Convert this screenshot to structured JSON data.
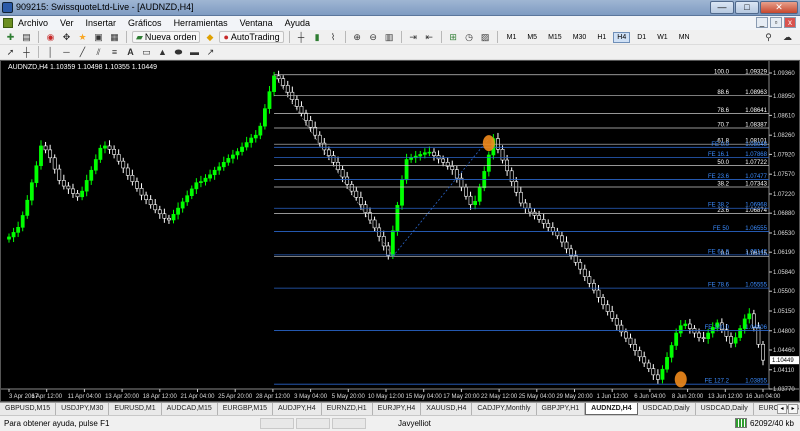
{
  "window": {
    "title": "909215: SwissquoteLtd-Live - [AUDNZD,H4]",
    "controls": [
      "—",
      "□",
      "✕"
    ]
  },
  "menu": {
    "items": [
      "Archivo",
      "Ver",
      "Insertar",
      "Gráficos",
      "Herramientas",
      "Ventana",
      "Ayuda"
    ],
    "mdi_controls": [
      "_",
      "▫",
      "x"
    ]
  },
  "toolbar": {
    "new_order_label": "Nueva orden",
    "autotrading_label": "AutoTrading",
    "timeframes": [
      "M1",
      "M5",
      "M15",
      "M30",
      "H1",
      "H4",
      "D1",
      "W1",
      "MN"
    ],
    "active_timeframe": "H4"
  },
  "chart_info": "AUDNZD,H4  1.10359 1.10498 1.10355 1.10449",
  "chart_data": {
    "type": "candlestick",
    "symbol": "AUDNZD",
    "timeframe": "H4",
    "ohlc_header": {
      "open": 1.10359,
      "high": 1.10498,
      "low": 1.10355,
      "close": 1.10449
    },
    "ylim": [
      1.0377,
      1.0936
    ],
    "y_ticks": [
      1.0936,
      1.0895,
      1.0861,
      1.0826,
      1.0792,
      1.0757,
      1.0722,
      1.0688,
      1.0653,
      1.0619,
      1.0584,
      1.055,
      1.0515,
      1.048,
      1.0446,
      1.0411,
      1.0377
    ],
    "x_ticks": [
      "3 Apr 2017",
      "6 Apr 12:00",
      "11 Apr 04:00",
      "13 Apr 20:00",
      "18 Apr 12:00",
      "21 Apr 04:00",
      "25 Apr 20:00",
      "28 Apr 12:00",
      "3 May 04:00",
      "5 May 20:00",
      "10 May 12:00",
      "15 May 04:00",
      "17 May 20:00",
      "22 May 12:00",
      "25 May 04:00",
      "29 May 20:00",
      "1 Jun 12:00",
      "6 Jun 04:00",
      "8 Jun 20:00",
      "13 Jun 12:00",
      "16 Jun 04:00"
    ],
    "close_series": [
      1.0646,
      1.0654,
      1.0663,
      1.0684,
      1.0711,
      1.0742,
      1.0772,
      1.0807,
      1.08,
      1.0786,
      1.0766,
      1.0746,
      1.0736,
      1.0731,
      1.0723,
      1.0717,
      1.0727,
      1.0746,
      1.0764,
      1.0783,
      1.0803,
      1.0807,
      1.0801,
      1.0792,
      1.078,
      1.0768,
      1.0755,
      1.0744,
      1.0732,
      1.072,
      1.0712,
      1.0703,
      1.0694,
      1.0687,
      1.0679,
      1.0676,
      1.0686,
      1.0697,
      1.0708,
      1.0719,
      1.0731,
      1.0742,
      1.0744,
      1.075,
      1.0756,
      1.0764,
      1.077,
      1.0778,
      1.0785,
      1.0791,
      1.0797,
      1.0805,
      1.0813,
      1.0821,
      1.0826,
      1.0842,
      1.0873,
      1.0903,
      1.0931,
      1.0926,
      1.0914,
      1.0902,
      1.0889,
      1.0877,
      1.0865,
      1.0852,
      1.084,
      1.0826,
      1.0812,
      1.08,
      1.079,
      1.0778,
      1.0765,
      1.0752,
      1.0739,
      1.0727,
      1.0716,
      1.0703,
      1.0689,
      1.0676,
      1.0662,
      1.0647,
      1.063,
      1.0613,
      1.0657,
      1.0702,
      1.0747,
      1.0783,
      1.0786,
      1.0789,
      1.0792,
      1.0795,
      1.0796,
      1.079,
      1.0784,
      1.0778,
      1.0771,
      1.0765,
      1.075,
      1.0734,
      1.0718,
      1.0703,
      1.0709,
      1.0733,
      1.0762,
      1.0791,
      1.082,
      1.0801,
      1.0782,
      1.0763,
      1.0744,
      1.0725,
      1.0706,
      1.0697,
      1.069,
      1.0684,
      1.0677,
      1.067,
      1.0663,
      1.0656,
      1.0648,
      1.0637,
      1.0625,
      1.0613,
      1.0601,
      1.0589,
      1.0576,
      1.0564,
      1.0552,
      1.0539,
      1.0526,
      1.0514,
      1.0502,
      1.049,
      1.0478,
      1.0467,
      1.0456,
      1.0445,
      1.0434,
      1.0423,
      1.0413,
      1.0402,
      1.0394,
      1.0412,
      1.0433,
      1.0454,
      1.0476,
      1.0489,
      1.0492,
      1.0484,
      1.0476,
      1.0468,
      1.0466,
      1.0476,
      1.0486,
      1.0494,
      1.0482,
      1.047,
      1.0458,
      1.0468,
      1.0484,
      1.0501,
      1.051,
      1.0486,
      1.0456,
      1.0428
    ],
    "fibonacci_retracement": [
      {
        "level": "100.0",
        "price": 1.09329
      },
      {
        "level": "88.6",
        "price": 1.08963
      },
      {
        "level": "78.6",
        "price": 1.08641
      },
      {
        "level": "70.7",
        "price": 1.08387
      },
      {
        "level": "61.8",
        "price": 1.08101
      },
      {
        "level": "50.0",
        "price": 1.07722
      },
      {
        "level": "38.2",
        "price": 1.07343
      },
      {
        "level": "23.6",
        "price": 1.06874
      },
      {
        "level": "0.0",
        "price": 1.06115
      }
    ],
    "fibonacci_expansion": [
      {
        "label": "FE 0.0",
        "price": 1.08045
      },
      {
        "label": "FE 16.1",
        "price": 1.07868
      },
      {
        "label": "FE 23.6",
        "price": 1.07477
      },
      {
        "label": "FE 38.2",
        "price": 1.06968
      },
      {
        "label": "FE 50",
        "price": 1.06555
      },
      {
        "label": "FE 61.8",
        "price": 1.06142
      },
      {
        "label": "FE 78.6",
        "price": 1.05555
      },
      {
        "label": "FE 100.0",
        "price": 1.04806
      },
      {
        "label": "FE 127.2",
        "price": 1.03855
      }
    ],
    "highlight_ovals": [
      {
        "color": "#f08a1c",
        "price": 1.0812,
        "index": 105
      },
      {
        "color": "#f08a1c",
        "price": 1.0394,
        "index": 147
      }
    ]
  },
  "tabs": [
    "GBPUSD,M15",
    "USDJPY,M30",
    "EURUSD,M1",
    "AUDCAD,M15",
    "EURGBP,M15",
    "AUDJPY,H4",
    "EURNZD,H1",
    "EURJPY,H4",
    "XAUUSD,H4",
    "CADJPY,Monthly",
    "GBPJPY,H1",
    "AUDNZD,H4",
    "USDCAD,Daily",
    "USDCAD,Daily",
    "EURCAD,H4"
  ],
  "active_tab": "AUDNZD,H4",
  "tab_arrows": [
    "◂",
    "▸"
  ],
  "status": {
    "help": "Para obtener ayuda, pulse F1",
    "profile": "Javyelliot",
    "connection": "62092/40 kb"
  },
  "colors": {
    "bull": "#00ff00",
    "bear": "#ffffff",
    "fib": "#c8c8c8",
    "fe": "#2a64c8",
    "highlight": "#f08a1c",
    "background": "#000000"
  }
}
